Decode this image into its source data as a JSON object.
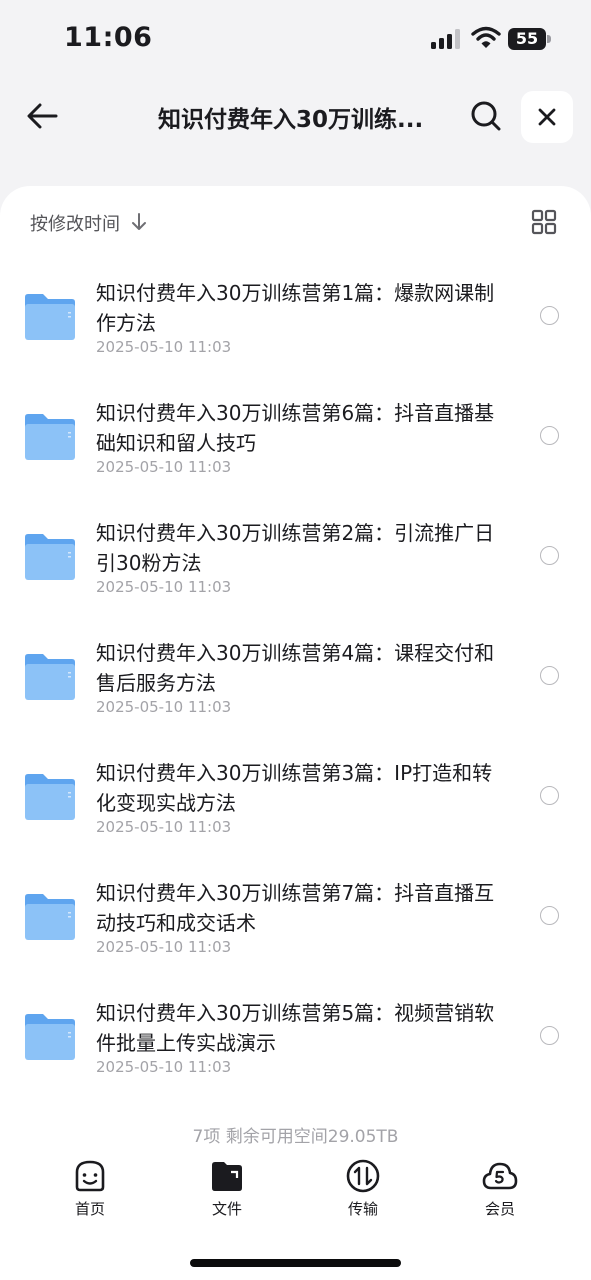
{
  "status_bar": {
    "time": "11:06",
    "battery": "55"
  },
  "header": {
    "title": "知识付费年入30万训练...",
    "back_icon": "arrow-left-icon",
    "search_icon": "search-icon",
    "close_icon": "close-icon"
  },
  "toolbar": {
    "sort_label": "按修改时间",
    "sort_icon": "arrow-down-icon",
    "view_icon": "grid-view-icon"
  },
  "files": [
    {
      "name": "知识付费年入30万训练营第1篇：爆款网课制作方法",
      "date": "2025-05-10 11:03"
    },
    {
      "name": "知识付费年入30万训练营第6篇：抖音直播基础知识和留人技巧",
      "date": "2025-05-10 11:03"
    },
    {
      "name": "知识付费年入30万训练营第2篇：引流推广日引30粉方法",
      "date": "2025-05-10 11:03"
    },
    {
      "name": "知识付费年入30万训练营第4篇：课程交付和售后服务方法",
      "date": "2025-05-10 11:03"
    },
    {
      "name": "知识付费年入30万训练营第3篇：IP打造和转化变现实战方法",
      "date": "2025-05-10 11:03"
    },
    {
      "name": "知识付费年入30万训练营第7篇：抖音直播互动技巧和成交话术",
      "date": "2025-05-10 11:03"
    },
    {
      "name": "知识付费年入30万训练营第5篇：视频营销软件批量上传实战演示",
      "date": "2025-05-10 11:03"
    }
  ],
  "summary": "7项 剩余可用空间29.05TB",
  "tabs": [
    {
      "label": "首页",
      "icon": "home-face-icon"
    },
    {
      "label": "文件",
      "icon": "folder-file-icon"
    },
    {
      "label": "传输",
      "icon": "transfer-icon"
    },
    {
      "label": "会员",
      "icon": "member-cloud-icon"
    }
  ],
  "colors": {
    "background": "#f3f3f5",
    "card": "#ffffff",
    "folder": "#7ab8f5",
    "secondary_text": "#a3a3a8"
  }
}
